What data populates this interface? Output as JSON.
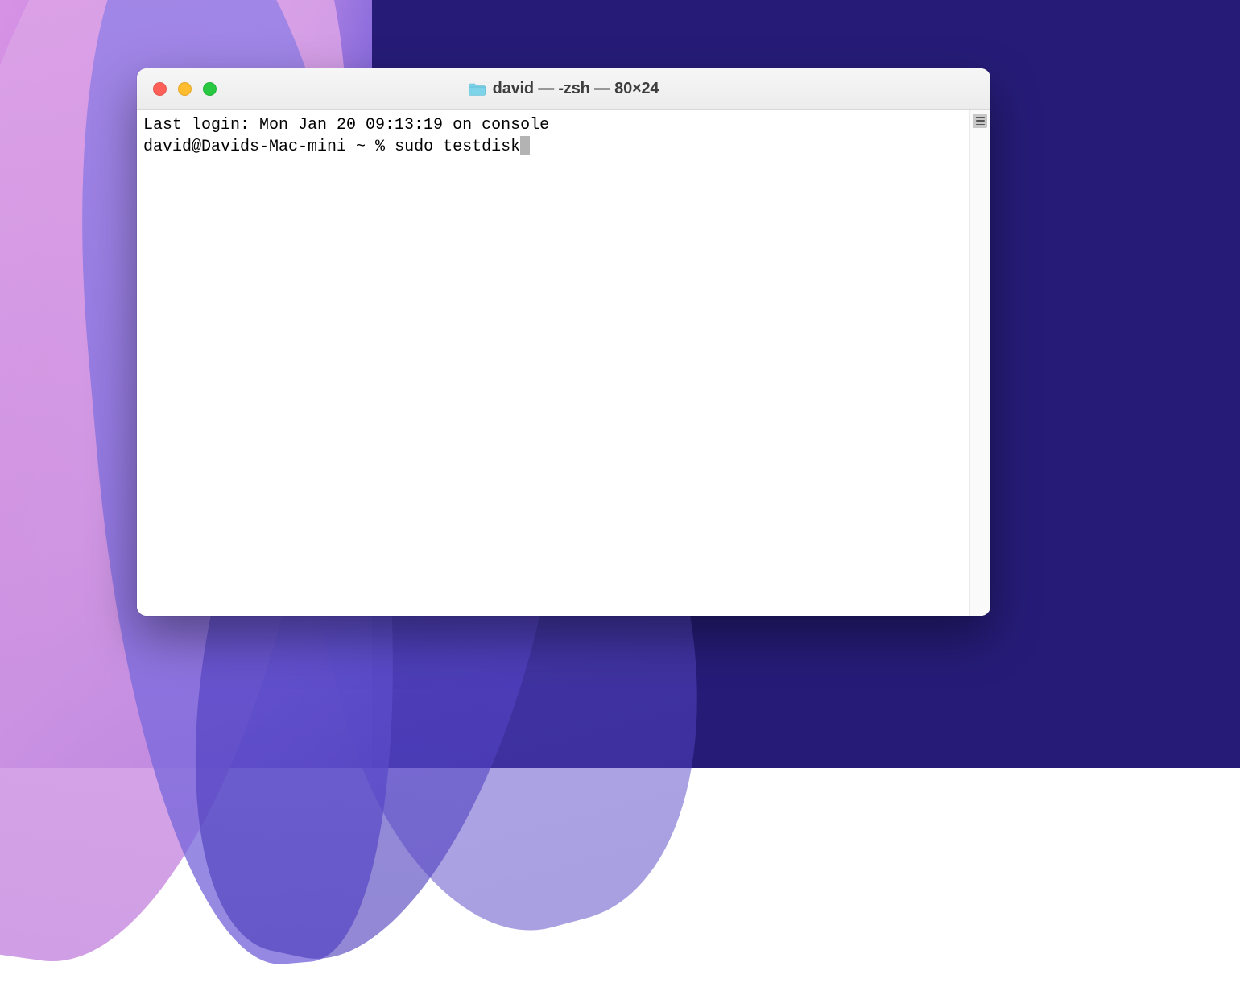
{
  "window": {
    "title": "david — -zsh — 80×24"
  },
  "terminal": {
    "last_login": "Last login: Mon Jan 20 09:13:19 on console",
    "prompt": "david@Davids-Mac-mini ~ % ",
    "command": "sudo testdisk"
  }
}
